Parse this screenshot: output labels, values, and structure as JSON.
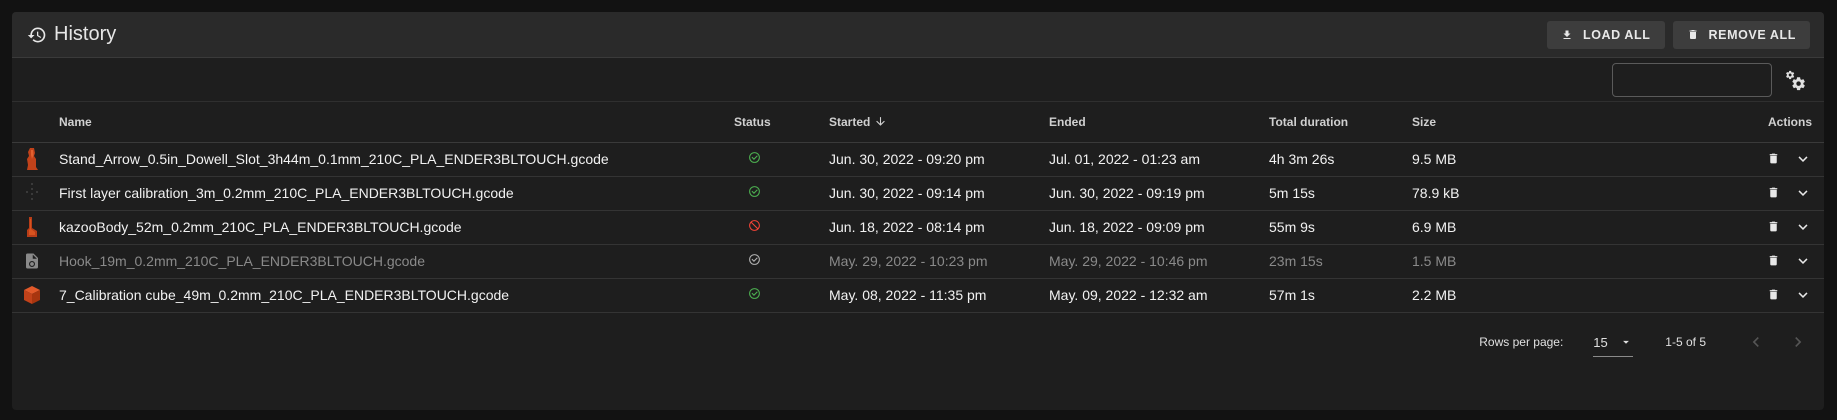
{
  "header": {
    "title": "History",
    "load_all_label": "LOAD ALL",
    "remove_all_label": "REMOVE ALL",
    "history_icon": "history-icon",
    "download_icon": "download-icon",
    "trash_icon": "trash-icon"
  },
  "toolbar": {
    "search_value": "",
    "search_icon": "search-icon",
    "settings_icon": "cogs-icon"
  },
  "table": {
    "columns": {
      "name": "Name",
      "status": "Status",
      "started": "Started",
      "ended": "Ended",
      "duration": "Total duration",
      "size": "Size",
      "actions": "Actions"
    },
    "sort_icon": "arrow-down-icon",
    "rows": [
      {
        "name": "Stand_Arrow_0.5in_Dowell_Slot_3h44m_0.1mm_210C_PLA_ENDER3BLTOUCH.gcode",
        "status": "completed",
        "started": "Jun. 30, 2022 - 09:20 pm",
        "ended": "Jul. 01, 2022 - 01:23 am",
        "duration": "4h 3m 26s",
        "size": "9.5 MB",
        "thumb": "arrow-model-thumbnail",
        "dim": false
      },
      {
        "name": "First layer calibration_3m_0.2mm_210C_PLA_ENDER3BLTOUCH.gcode",
        "status": "completed",
        "started": "Jun. 30, 2022 - 09:14 pm",
        "ended": "Jun. 30, 2022 - 09:19 pm",
        "duration": "5m 15s",
        "size": "78.9 kB",
        "thumb": "calibration-layer-thumbnail",
        "dim": false
      },
      {
        "name": "kazooBody_52m_0.2mm_210C_PLA_ENDER3BLTOUCH.gcode",
        "status": "cancelled",
        "started": "Jun. 18, 2022 - 08:14 pm",
        "ended": "Jun. 18, 2022 - 09:09 pm",
        "duration": "55m 9s",
        "size": "6.9 MB",
        "thumb": "kazoo-model-thumbnail",
        "dim": false
      },
      {
        "name": "Hook_19m_0.2mm_210C_PLA_ENDER3BLTOUCH.gcode",
        "status": "completed-missing",
        "started": "May. 29, 2022 - 10:23 pm",
        "ended": "May. 29, 2022 - 10:46 pm",
        "duration": "23m 15s",
        "size": "1.5 MB",
        "thumb": "file-missing-icon",
        "dim": true
      },
      {
        "name": "7_Calibration cube_49m_0.2mm_210C_PLA_ENDER3BLTOUCH.gcode",
        "status": "completed",
        "started": "May. 08, 2022 - 11:35 pm",
        "ended": "May. 09, 2022 - 12:32 am",
        "duration": "57m 1s",
        "size": "2.2 MB",
        "thumb": "cube-model-thumbnail",
        "dim": false
      }
    ]
  },
  "footer": {
    "rows_per_page_label": "Rows per page:",
    "rows_per_page_value": "15",
    "range": "1-5 of 5"
  },
  "colors": {
    "success": "#4caf50",
    "error": "#f44336",
    "muted": "#8a8a8a",
    "model_orange": "#d8491c"
  }
}
